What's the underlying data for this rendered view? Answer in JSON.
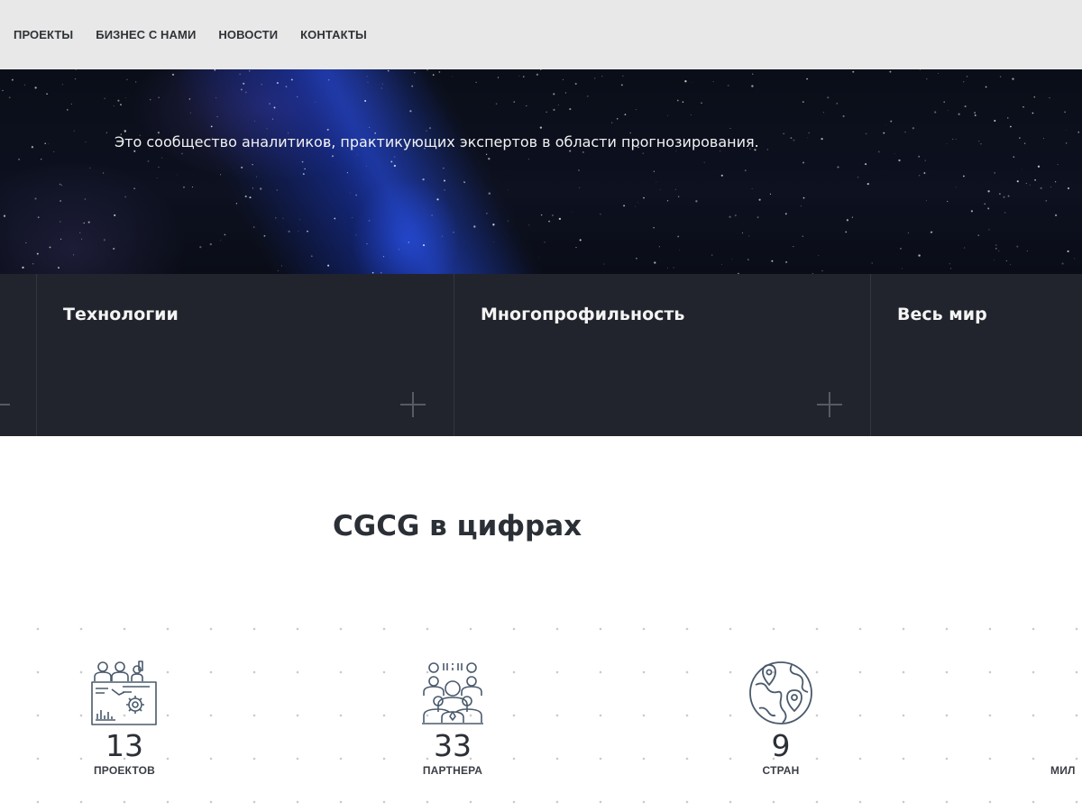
{
  "nav": {
    "items": [
      "ПРОЕКТЫ",
      "БИЗНЕС С НАМИ",
      "НОВОСТИ",
      "КОНТАКТЫ"
    ]
  },
  "hero": {
    "tagline": "Это сообщество аналитиков, практикующих экспертов в области прогнозирования."
  },
  "features": [
    {
      "title": "Технологии"
    },
    {
      "title": "Многопрофильность"
    },
    {
      "title": "Весь мир"
    }
  ],
  "stats": {
    "title": "CGCG в цифрах",
    "items": [
      {
        "number": "13",
        "label": "ПРОЕКТОВ",
        "icon": "team-meeting-icon"
      },
      {
        "number": "33",
        "label": "ПАРТНЕРА",
        "icon": "partners-group-icon"
      },
      {
        "number": "9",
        "label": "СТРАН",
        "icon": "globe-pins-icon"
      },
      {
        "number": "",
        "label": "МИЛ",
        "icon": "partial-icon"
      }
    ]
  },
  "colors": {
    "nav_bg": "#e8e8e8",
    "strip_bg": "#21242c",
    "icon": "#4a5a6c",
    "text_dark": "#2b2f36"
  }
}
